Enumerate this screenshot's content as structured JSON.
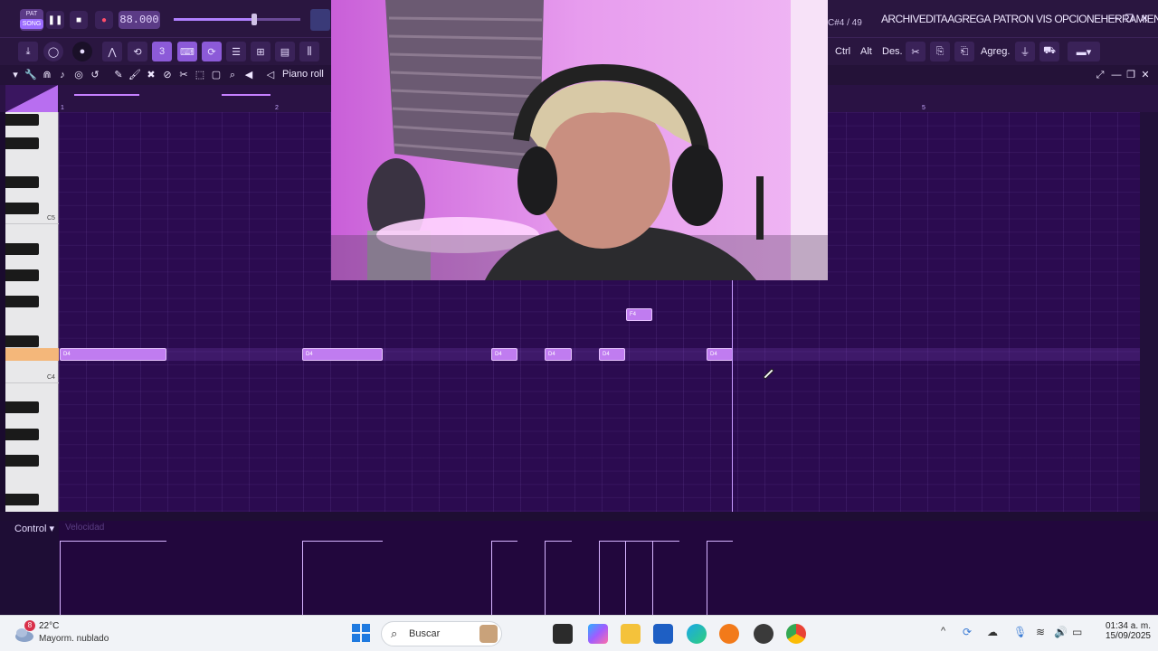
{
  "transport": {
    "mode_pat": "PAT",
    "mode_song": "SONG",
    "tempo": "88.000"
  },
  "header": {
    "counter": "C#4 / 49",
    "menu": [
      "ARCHIV",
      "EDITA",
      "AGREGA",
      "PATRON",
      "VIS",
      "OPCIONE",
      "HERRAMIENT",
      "A"
    ]
  },
  "toolbar": {
    "ctrl_label": "Ctrl",
    "alt_label": "Alt",
    "des_label": "Des.",
    "agreg_label": "Agreg."
  },
  "piano_roll": {
    "title": "Piano roll",
    "bar_numbers": [
      "1",
      "2",
      "5"
    ],
    "key_labels": [
      "C5",
      "C4"
    ],
    "notes": [
      {
        "label": "D4"
      },
      {
        "label": "D4"
      },
      {
        "label": "D4"
      },
      {
        "label": "D4"
      },
      {
        "label": "D4"
      },
      {
        "label": "D4"
      },
      {
        "label": "F4"
      }
    ]
  },
  "control": {
    "label": "Control",
    "parameter": "Velocidad"
  },
  "taskbar": {
    "weather_badge": "8",
    "temperature": "22°C",
    "weather_desc": "Mayorm. nublado",
    "search_placeholder": "Buscar",
    "time": "01:34 a. m.",
    "date": "15/09/2025"
  },
  "colors": {
    "accent": "#9b6cff",
    "note": "#c07cf0",
    "grid_bg": "#2b0b50"
  }
}
